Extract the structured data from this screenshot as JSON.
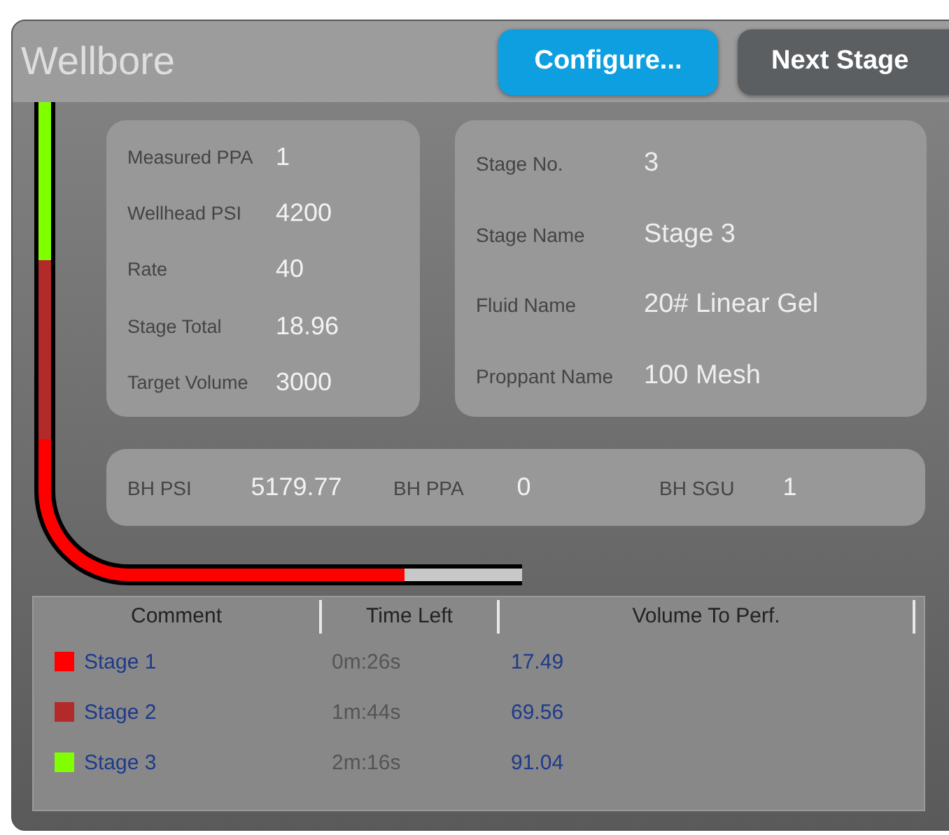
{
  "window": {
    "title": "Wellbore"
  },
  "buttons": [
    {
      "label": "Configure...",
      "kind": "primary"
    },
    {
      "label": "Next Stage",
      "kind": "secondary"
    }
  ],
  "measurements": [
    {
      "label": "Measured PPA",
      "value": "1"
    },
    {
      "label": "Wellhead PSI",
      "value": "4200"
    },
    {
      "label": "Rate",
      "value": "40"
    },
    {
      "label": "Stage Total",
      "value": "18.96"
    },
    {
      "label": "Target Volume",
      "value": "3000"
    }
  ],
  "stage_info": [
    {
      "label": "Stage No.",
      "value": "3"
    },
    {
      "label": "Stage Name",
      "value": "Stage 3"
    },
    {
      "label": "Fluid Name",
      "value": "20# Linear Gel"
    },
    {
      "label": "Proppant Name",
      "value": "100 Mesh"
    }
  ],
  "bottom_hole": [
    {
      "label": "BH PSI",
      "value": "5179.77"
    },
    {
      "label": "BH PPA",
      "value": "0"
    },
    {
      "label": "BH SGU",
      "value": "1"
    }
  ],
  "table": {
    "columns": [
      "Comment",
      "Time Left",
      "Volume To Perf."
    ],
    "rows": [
      {
        "comment": "Stage 1",
        "color": "#ff0000",
        "time_left": "0m:26s",
        "volume": "17.49"
      },
      {
        "comment": "Stage 2",
        "color": "#b22a2a",
        "time_left": "1m:44s",
        "volume": "69.56"
      },
      {
        "comment": "Stage 3",
        "color": "#80ff00",
        "time_left": "2m:16s",
        "volume": "91.04"
      }
    ]
  }
}
